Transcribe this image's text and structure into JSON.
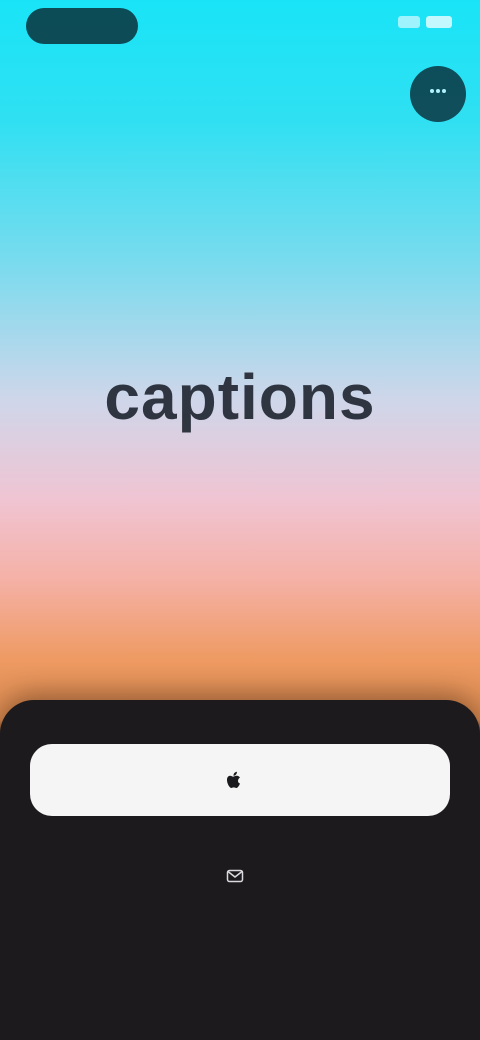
{
  "status_bar": {
    "time": "",
    "signal_icon": "signal-icon",
    "battery_icon": "battery-icon"
  },
  "corner_button": {
    "icon": "menu-icon"
  },
  "brand": {
    "name": "captions",
    "tagline": ""
  },
  "sheet": {
    "primary_button_label": "",
    "primary_button_icon": "apple-icon",
    "secondary_button_label": "",
    "secondary_button_icon": "mail-icon",
    "footer_link_label": ""
  },
  "colors": {
    "gradient_top": "#19e4f7",
    "gradient_mid": "#cfd6ea",
    "gradient_warm": "#ee9a62",
    "sheet_background": "#1c1a1d",
    "primary_button_background": "#f5f5f5",
    "brand_text": "#222833"
  }
}
